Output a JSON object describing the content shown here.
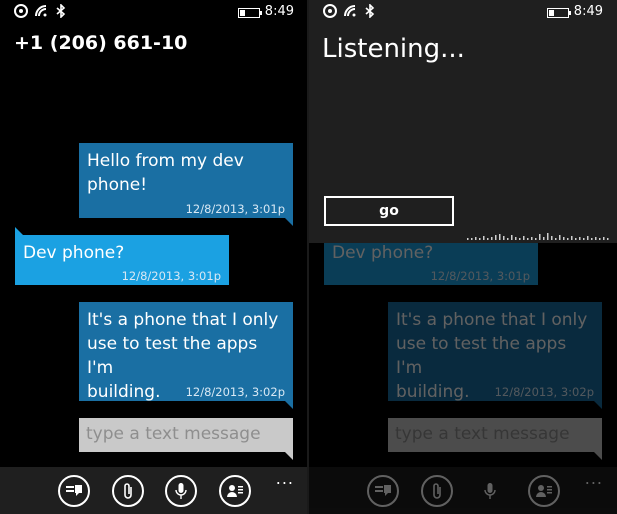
{
  "status": {
    "time": "8:49",
    "battery_level": 0.3
  },
  "conversation": {
    "contact": "+1 (206) 661-10",
    "messages": [
      {
        "text": "Hello from my dev phone!",
        "lines": [
          "Hello from my dev",
          "phone!"
        ],
        "timestamp": "12/8/2013, 3:01p",
        "direction": "outgoing"
      },
      {
        "text": "Dev phone?",
        "lines": [
          "Dev phone?"
        ],
        "timestamp": "12/8/2013, 3:01p",
        "direction": "incoming"
      },
      {
        "text": "It's a phone that I only use to test the apps I'm building.",
        "lines": [
          "It's a phone that I only",
          "use to test the apps I'm",
          "building."
        ],
        "timestamp": "12/8/2013, 3:02p",
        "direction": "outgoing"
      }
    ],
    "input_placeholder": "type a text message"
  },
  "app_bar": {
    "buttons": [
      "switch-conversation-icon",
      "attach-icon",
      "microphone-icon",
      "contact-card-icon"
    ],
    "more": "..."
  },
  "speech": {
    "status": "Listening...",
    "go_label": "go"
  },
  "colors": {
    "outgoing": "#1a6fa3",
    "incoming": "#1ba1e2",
    "appbar": "#1f1f1f",
    "input": "#c9c9c9"
  }
}
